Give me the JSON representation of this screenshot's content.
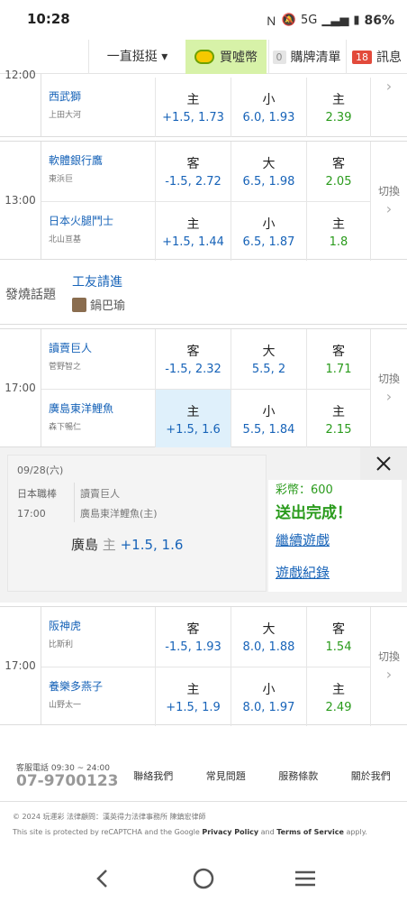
{
  "status_bar": {
    "time": "10:28",
    "battery": "86%",
    "network": "5G"
  },
  "top_nav": {
    "dropdown_label": "一直挺挺 ▾",
    "coin_label": "買噓幣",
    "cart_count": "0",
    "cart_label": "購牌清單",
    "message_count": "18",
    "message_label": "訊息"
  },
  "games": [
    {
      "time": "12:00",
      "more_label": "",
      "teams": [
        {
          "name": "西武獅",
          "pitcher": "上田大河",
          "odds": [
            {
              "label": "主",
              "value": "+1.5, 1.73"
            },
            {
              "label": "小",
              "value": "6.0, 1.93"
            },
            {
              "label": "主",
              "value": "2.39"
            }
          ]
        }
      ]
    },
    {
      "time": "13:00",
      "more_label": "切換",
      "teams": [
        {
          "name": "軟體銀行鷹",
          "pitcher": "東浜巨",
          "odds": [
            {
              "label": "客",
              "value": "-1.5, 2.72"
            },
            {
              "label": "大",
              "value": "6.5, 1.98"
            },
            {
              "label": "客",
              "value": "2.05"
            }
          ]
        },
        {
          "name": "日本火腿鬥士",
          "pitcher": "北山亘基",
          "odds": [
            {
              "label": "主",
              "value": "+1.5, 1.44"
            },
            {
              "label": "小",
              "value": "6.5, 1.87"
            },
            {
              "label": "主",
              "value": "1.8"
            }
          ]
        }
      ]
    },
    {
      "time": "17:00",
      "more_label": "切換",
      "teams": [
        {
          "name": "讀賣巨人",
          "pitcher": "菅野智之",
          "odds": [
            {
              "label": "客",
              "value": "-1.5, 2.32"
            },
            {
              "label": "大",
              "value": "5.5, 2"
            },
            {
              "label": "客",
              "value": "1.71"
            }
          ]
        },
        {
          "name": "廣島東洋鯉魚",
          "pitcher": "森下暢仁",
          "odds": [
            {
              "label": "主",
              "value": "+1.5, 1.6"
            },
            {
              "label": "小",
              "value": "5.5, 1.84"
            },
            {
              "label": "主",
              "value": "2.15"
            }
          ]
        }
      ]
    },
    {
      "time": "17:00",
      "more_label": "切換",
      "teams": [
        {
          "name": "阪神虎",
          "pitcher": "比斯利",
          "odds": [
            {
              "label": "客",
              "value": "-1.5, 1.93"
            },
            {
              "label": "大",
              "value": "8.0, 1.88"
            },
            {
              "label": "客",
              "value": "1.54"
            }
          ]
        },
        {
          "name": "養樂多燕子",
          "pitcher": "山野太一",
          "odds": [
            {
              "label": "主",
              "value": "+1.5, 1.9"
            },
            {
              "label": "小",
              "value": "8.0, 1.97"
            },
            {
              "label": "主",
              "value": "2.49"
            }
          ]
        }
      ]
    }
  ],
  "hot_topic": {
    "label": "發燒話題",
    "title": "工友請進",
    "author": "鍋巴瑜"
  },
  "bet_popup": {
    "date": "09/28(六)",
    "league": "日本職棒",
    "time": "17:00",
    "away_team": "讀賣巨人",
    "home_team": "廣島東洋鯉魚(主)",
    "pick_team": "廣島",
    "pick_side": "主",
    "pick_odds": "+1.5, 1.6",
    "coins": "彩幣：600",
    "status": "送出完成！",
    "continue_label": "繼續遊戲",
    "history_label": "遊戲紀錄"
  },
  "footer": {
    "service_hours": "客服電話 09:30 ~ 24:00",
    "phone": "07-9700123",
    "links": [
      "聯絡我們",
      "常見問題",
      "服務條款",
      "關於我們"
    ],
    "copyright": "© 2024 玩運彩 法律顧問：漢英得力法律事務所 陳鎮宏律師",
    "captcha_prefix": "This site is protected by reCAPTCHA and the Google ",
    "privacy": "Privacy Policy",
    "and": " and ",
    "terms": "Terms of Service",
    "apply": " apply."
  },
  "colors": {
    "link_blue": "#1763b8",
    "odds_green": "#2a9b1c",
    "selected_bg": "#dff0fb",
    "coin_bg": "#d7f2a8",
    "badge_red": "#e24a3b"
  }
}
